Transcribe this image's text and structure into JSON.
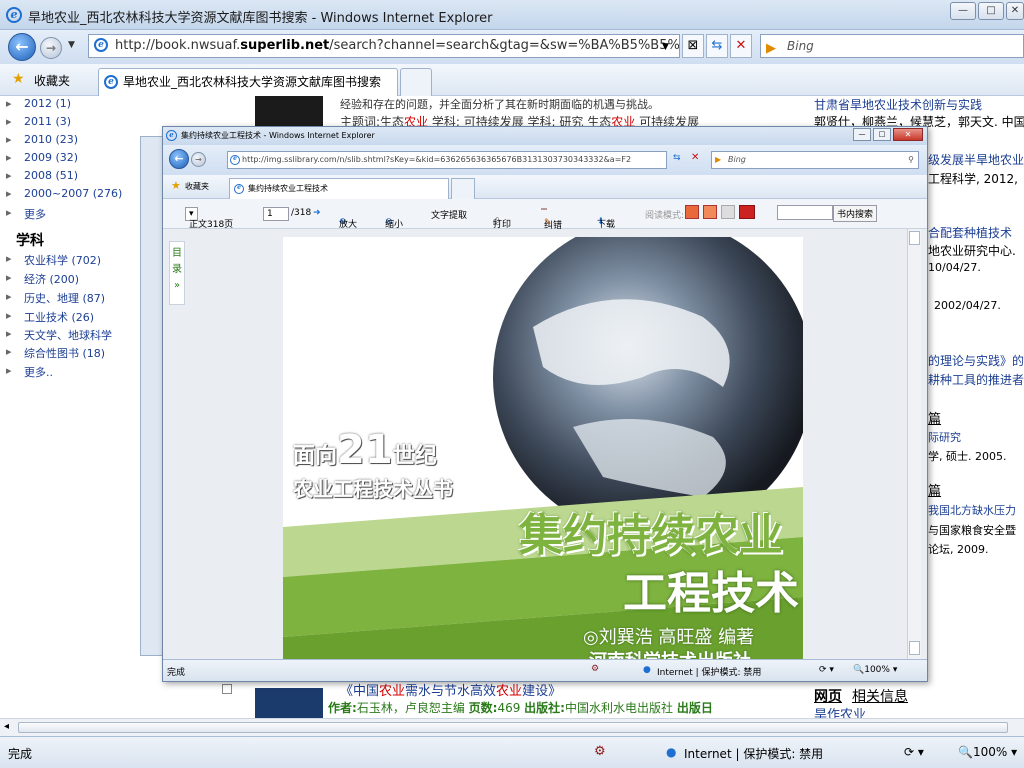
{
  "window": {
    "title": "旱地农业_西北农林科技大学资源文献库图书搜索 - Windows Internet Explorer"
  },
  "nav": {
    "address": "http://book.nwsuaf.superlib.net/search?channel=search&gtag=&sw=%BA%B5%B5%D8%C",
    "address_prefix": "http://book.nwsuaf.",
    "address_domain": "superlib.net",
    "address_rest": "/search?channel=search&gtag=&sw=%BA%B5%B5%D8%C",
    "search_engine": "Bing"
  },
  "favorites": {
    "label": "收藏夹",
    "tab_label": "旱地农业_西北农林科技大学资源文献库图书搜索"
  },
  "sidebar": {
    "years": [
      "2012 (1)",
      "2011 (3)",
      "2010 (23)",
      "2009 (32)",
      "2008 (51)",
      "2000~2007 (276)",
      "更多"
    ],
    "subject_heading": "学科",
    "subjects": [
      "农业科学 (702)",
      "经济 (200)",
      "历史、地理 (87)",
      "工业技术 (26)",
      "天文学、地球科学",
      "综合性图书 (18)",
      "更多.."
    ]
  },
  "results": {
    "line1": "经验和存在的问题，并全面分析了其在新时期面临的机遇与挑战。",
    "line2_a": "主题词:生态",
    "line2_b": "农业",
    "line2_c": " 学科: 可持续发展 学科: 研究 生态",
    "line2_d": "农业",
    "line2_e": " 可持续发展",
    "bottom_title_a": "《中国",
    "bottom_title_b": "农业",
    "bottom_title_c": "需水与节水高效",
    "bottom_title_d": "农业",
    "bottom_title_e": "建设》",
    "bottom_meta_author_label": "作者:",
    "bottom_meta_author": "石玉林，卢良恕主编 ",
    "bottom_meta_pages_label": "页数:",
    "bottom_meta_pages": "469 ",
    "bottom_meta_pub_label": "出版社:",
    "bottom_meta_pub": "中国水利水电出版社 ",
    "bottom_meta_date_label": "出版日"
  },
  "right_column": {
    "r1": "甘肃省旱地农业技术创新与实践",
    "r2": "郭贤仕，柳燕兰，候慧芝，郭天文. 中国",
    "r3": "级发展半旱地农业的",
    "r4": "工程科学, 2012,",
    "r5": "合配套种植技术",
    "r6": "地农业研究中心. ",
    "r7": "10/04/27.",
    "r8": "2002/04/27.",
    "r9": "的理论与实践》的",
    "r10": "耕种工具的推进者",
    "r11": "篇",
    "r12": "际研究",
    "r13": "学, 硕士. 2005.",
    "r14": "篇",
    "r15": "我国北方缺水压力",
    "r16": "与国家粮食安全暨",
    "r17": "论坛, 2009.",
    "web_label": "网页",
    "related_label": "相关信息",
    "related_link": "旱作农业"
  },
  "status": {
    "left": "完成",
    "zone": "Internet | 保护模式: 禁用",
    "zoom": "100%"
  },
  "popup": {
    "title": "集约持续农业工程技术 - Windows Internet Explorer",
    "address": "http://img.sslibrary.com/n/slib.shtml?sKey=&kid=636265636365676B3131303730343332&a=F2",
    "search_engine": "Bing",
    "fav_label": "收藏夹",
    "tab_label": "集约持续农业工程技术",
    "toolbar": {
      "page_select": "正文318页",
      "page_num": "1",
      "page_total": "/318",
      "zoom_in": "放大",
      "zoom_out": "缩小",
      "extract": "文字提取",
      "print": "打印",
      "correct": "纠错",
      "download": "下载",
      "read_mode": "阅读模式:",
      "search_btn": "书内搜索"
    },
    "toc": "目录",
    "toc_arrow": "»",
    "status_left": "完成",
    "status_zone": "Internet | 保护模式: 禁用",
    "status_zoom": "100%",
    "cover": {
      "series_a": "面向",
      "series_num": "21",
      "series_b": "世纪",
      "series_c": "农业工程技术丛书",
      "title_1": "集约持续农业",
      "title_2": "工程技术",
      "authors": "◎刘巽浩  高旺盛  编著",
      "publisher": "河南科学技术出版社"
    }
  },
  "colors": {
    "accent": "#1c3f94",
    "highlight": "#d40000",
    "green": "#2a7a1a",
    "cover_green": "#7fb33f"
  }
}
